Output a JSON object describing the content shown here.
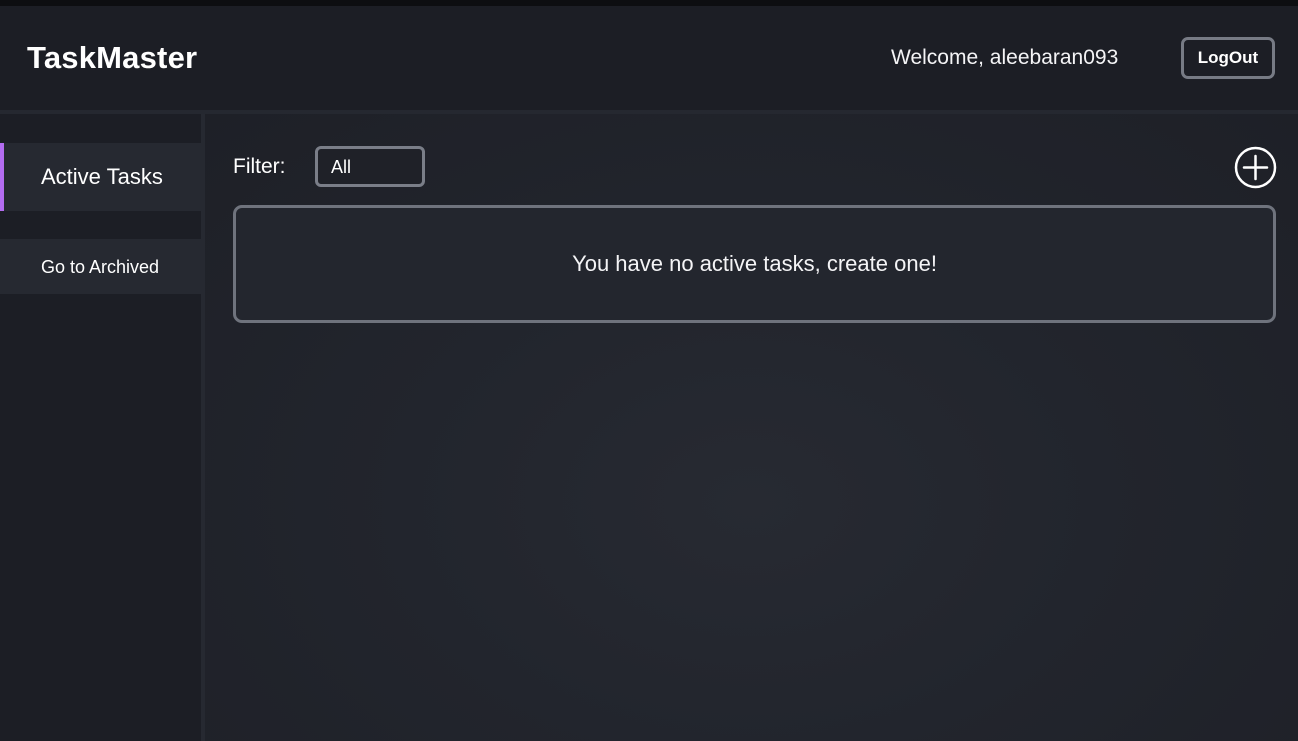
{
  "header": {
    "app_title": "TaskMaster",
    "welcome_text": "Welcome, aleebaran093",
    "logout_label": "LogOut"
  },
  "sidebar": {
    "items": [
      {
        "label": "Active Tasks",
        "active": true
      },
      {
        "label": "Go to Archived",
        "active": false
      }
    ],
    "accent_color": "#b36cf0"
  },
  "main": {
    "filter": {
      "label": "Filter:",
      "selected": "All"
    },
    "add_icon": "plus-circle-icon",
    "empty_message": "You have no active tasks, create one!"
  }
}
